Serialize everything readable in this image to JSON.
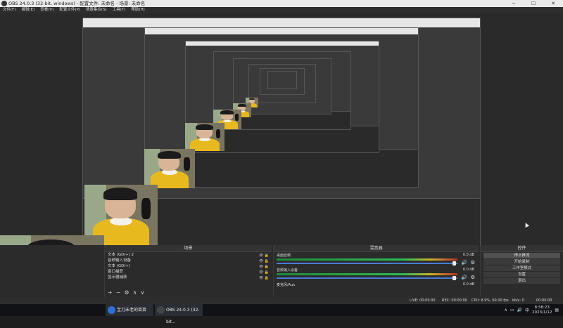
{
  "window": {
    "title": "OBS 24.0.3 (32-bit, windows) - 配置文件: 未命名 - 场景: 未命名",
    "controls": [
      "─",
      "☐",
      "✕"
    ]
  },
  "menu": [
    "文件(F)",
    "编辑(E)",
    "查看(V)",
    "配置文件(P)",
    "场景集合(S)",
    "工具(T)",
    "帮助(H)"
  ],
  "scenes_panel": {
    "title": "场景",
    "items": [
      "文本 (GDI+) 2",
      "音频输入设备",
      "文本 (GDI+)",
      "窗口捕获",
      "显示器捕获"
    ],
    "toolbar": [
      "+",
      "−",
      "⚙",
      "∧",
      "∨"
    ]
  },
  "mixer": {
    "title": "混音器",
    "channels": [
      {
        "name": "桌面音频",
        "value": "0.0 dB"
      },
      {
        "name": "音频输入设备",
        "value": "0.0 dB"
      },
      {
        "name": "麦克风/Aux",
        "value": "0.0 dB"
      }
    ]
  },
  "controls": {
    "title": "控件",
    "buttons": [
      "停止推流",
      "开始录制",
      "工作室模式",
      "设置",
      "退出"
    ]
  },
  "status": {
    "live": "LIVE: 00:00:00",
    "rec": "REC: 00:00:00",
    "cpu": "CPU: 8.9%, 60.00 fps",
    "kbps": "kb/s: 0",
    "time": "00:00:00"
  },
  "taskbar": {
    "items": [
      "宝刀未老的苗苗",
      "OBS 24.0.3 (32-bit..."
    ],
    "clock_time": "8:58:23",
    "clock_date": "2023/1/12",
    "tray_lang": "中"
  },
  "colors": {
    "accent": "#4a7bd5",
    "meter_green": "#2bbd55",
    "meter_red": "#b53030"
  }
}
